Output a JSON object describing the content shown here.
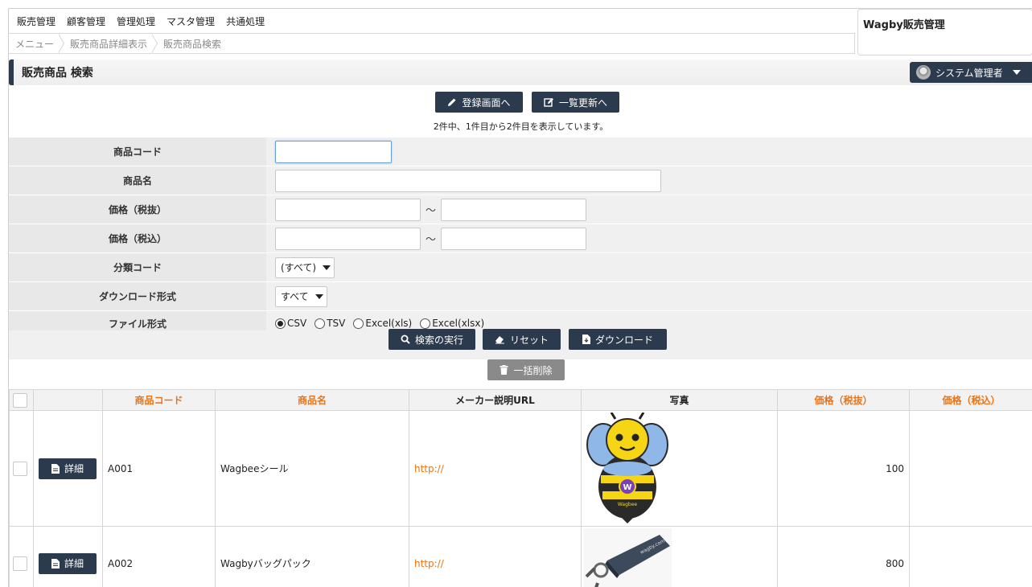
{
  "menu": [
    "販売管理",
    "顧客管理",
    "管理処理",
    "マスタ管理",
    "共通処理"
  ],
  "brand": "Wagby販売管理",
  "breadcrumb": [
    "メニュー",
    "販売商品詳細表示",
    "販売商品検索"
  ],
  "page_title": "販売商品 検索",
  "user": {
    "label": "システム管理者"
  },
  "actions": {
    "register": "登録画面へ",
    "bulk_update": "一覧更新へ"
  },
  "result_count": "2件中、1件目から2件目を表示しています。",
  "form": {
    "product_code_label": "商品コード",
    "product_name_label": "商品名",
    "price_ex_label": "価格（税抜）",
    "price_in_label": "価格（税込）",
    "category_label": "分類コード",
    "category_value": "(すべて)",
    "download_format_label": "ダウンロード形式",
    "download_format_value": "すべて",
    "file_format_label": "ファイル形式",
    "file_formats": [
      "CSV",
      "TSV",
      "Excel(xls)",
      "Excel(xlsx)"
    ],
    "selected_file_format": "CSV",
    "tilde": "～"
  },
  "buttons": {
    "search": "検索の実行",
    "reset": "リセット",
    "download": "ダウンロード",
    "bulk_delete": "一括削除"
  },
  "table": {
    "headers": [
      "商品コード",
      "商品名",
      "メーカー説明URL",
      "写真",
      "価格（税抜）",
      "価格（税込）"
    ],
    "detail_label": "詳細",
    "rows": [
      {
        "code": "A001",
        "name": "Wagbeeシール",
        "url": "http://",
        "price_ex": "100",
        "price_in": "",
        "photo_text": "Wagbee"
      },
      {
        "code": "A002",
        "name": "Wagbyバッグパック",
        "url": "http://",
        "price_ex": "800",
        "price_in": "",
        "photo_text": "wagby.com"
      }
    ]
  },
  "colors": {
    "navy": "#2b3a4d",
    "orange": "#e8741a",
    "form_bg": "#f0f0f0"
  }
}
